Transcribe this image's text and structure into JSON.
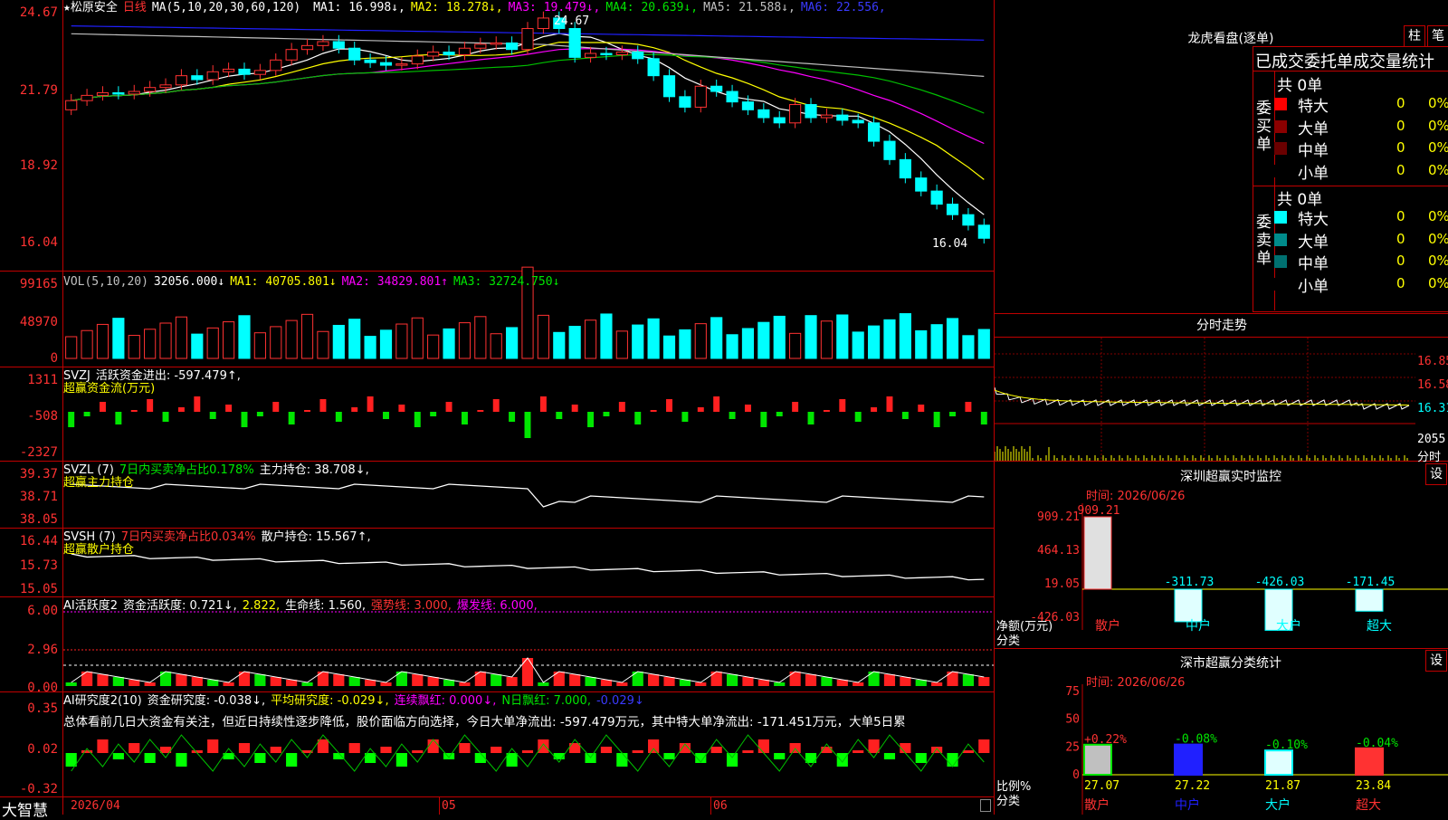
{
  "app": {
    "brand": "大智慧"
  },
  "stock": {
    "star": "★",
    "name": "松原安全",
    "period": "日线"
  },
  "main_panel": {
    "ma_label": "MA(5,10,20,30,60,120)",
    "ma": [
      {
        "name": "MA1",
        "value": "16.998↓",
        "color": "#ffffff"
      },
      {
        "name": "MA2",
        "value": "18.278↓",
        "color": "#ffff00"
      },
      {
        "name": "MA3",
        "value": "19.479↓",
        "color": "#ff00ff"
      },
      {
        "name": "MA4",
        "value": "20.639↓",
        "color": "#00e600"
      },
      {
        "name": "MA5",
        "value": "21.588↓",
        "color": "#c0c0c0"
      },
      {
        "name": "MA6",
        "value": "22.556",
        "color": "#3a3aff"
      }
    ],
    "y_ticks": [
      "24.67",
      "21.79",
      "18.92",
      "16.04"
    ],
    "high_label": "24.67",
    "low_label": "16.04"
  },
  "vol_panel": {
    "title": "VOL(5,10,20)",
    "value": "32056.000↓",
    "ma1": "MA1: 40705.801↓",
    "ma2": "MA2: 34829.801↑",
    "ma3": "MA3: 32724.750↓",
    "y_ticks": [
      "99165",
      "48970",
      "0"
    ]
  },
  "svzj_panel": {
    "title": "SVZJ",
    "label": "活跃资金进出: -597.479↑,",
    "sub": "超赢资金流(万元)",
    "y_ticks": [
      "1311",
      "-508",
      "-2327"
    ]
  },
  "svzl_panel": {
    "title": "SVZL (7)",
    "ratio": "7日内买卖净占比0.178%",
    "holding": "主力持仓: 38.708↓,",
    "sub": "超赢主力持仓",
    "y_ticks": [
      "39.37",
      "38.71",
      "38.05"
    ]
  },
  "svsh_panel": {
    "title": "SVSH (7)",
    "ratio": "7日内买卖净占比0.034%",
    "holding": "散户持仓: 15.567↑,",
    "sub": "超赢散户持仓",
    "y_ticks": [
      "16.44",
      "15.73",
      "15.05"
    ]
  },
  "ai_active_panel": {
    "title": "AI活跃度2",
    "active": "资金活跃度: 0.721↓,",
    "v2": "2.822,",
    "life": "生命线: 1.560,",
    "strong": "强势线: 3.000,",
    "burst": "爆发线: 6.000,",
    "y_ticks": [
      "6.00",
      "2.96",
      "0.00"
    ]
  },
  "ai_research_panel": {
    "title": "AI研究度2(10)",
    "research": "资金研究度: -0.038↓,",
    "avg": "平均研究度: -0.029↓,",
    "red_streak": "连续飘红: 0.000↓,",
    "n_red": "N日飘红: 7.000,",
    "last": "-0.029↓",
    "comment": "总体看前几日大资金有关注，但近日持续性逐步降低，股价面临方向选择，今日大单净流出: -597.479万元，其中特大单净流出: -171.451万元，大单5日累",
    "y_ticks": [
      "0.35",
      "0.02",
      "-0.32"
    ]
  },
  "x_axis": {
    "labels": [
      "2026/04",
      "05",
      "06"
    ]
  },
  "dragon_tiger": {
    "title": "龙虎看盘(逐单)",
    "btn_bar": "柱",
    "btn_pen": "笔",
    "header": "已成交委托单成交量统计",
    "buy_side": "委买单",
    "sell_side": "委卖单",
    "buy_total": "共 0单",
    "sell_total": "共 0单",
    "buy_rows": [
      {
        "label": "特大",
        "count": "0",
        "pct": "0%",
        "color": "#ff0000"
      },
      {
        "label": "大单",
        "count": "0",
        "pct": "0%",
        "color": "#8b0000"
      },
      {
        "label": "中单",
        "count": "0",
        "pct": "0%",
        "color": "#6a0000"
      },
      {
        "label": "小单",
        "count": "0",
        "pct": "0%",
        "color": "#000000"
      }
    ],
    "sell_rows": [
      {
        "label": "特大",
        "count": "0",
        "pct": "0%",
        "color": "#00ffff"
      },
      {
        "label": "大单",
        "count": "0",
        "pct": "0%",
        "color": "#008b8b"
      },
      {
        "label": "中单",
        "count": "0",
        "pct": "0%",
        "color": "#007070"
      },
      {
        "label": "小单",
        "count": "0",
        "pct": "0%",
        "color": "#000000"
      }
    ]
  },
  "intraday": {
    "title": "分时走势",
    "y_ticks": [
      "16.85",
      "16.58",
      "16.31"
    ],
    "vol_tick": "2055",
    "vol_unit": "分时"
  },
  "realtime_monitor": {
    "title": "深圳超赢实时监控",
    "btn": "设",
    "time": "时间: 2026/06/26",
    "y_ticks": [
      "909.21",
      "464.13",
      "19.05",
      "-426.03"
    ],
    "ylabel": "净额(万元)",
    "xlabel": "分类",
    "bars": [
      {
        "cat": "散户",
        "label": "909.21",
        "value": 909.21
      },
      {
        "cat": "中户",
        "label": "-311.73",
        "value": -311.73
      },
      {
        "cat": "大户",
        "label": "-426.03",
        "value": -426.03
      },
      {
        "cat": "超大",
        "label": "-171.45",
        "value": -171.45
      }
    ]
  },
  "category_stats": {
    "title": "深市超赢分类统计",
    "btn": "设",
    "time": "时间: 2026/06/26",
    "y_ticks": [
      "75",
      "50",
      "25",
      "0"
    ],
    "ylabel": "比例%",
    "xlabel": "分类",
    "bars": [
      {
        "cat": "散户",
        "top": "+0.22%",
        "value": 27.07,
        "label": "27.07"
      },
      {
        "cat": "中户",
        "top": "-0.08%",
        "value": 27.22,
        "label": "27.22"
      },
      {
        "cat": "大户",
        "top": "-0.10%",
        "value": 21.87,
        "label": "21.87"
      },
      {
        "cat": "超大",
        "top": "-0.04%",
        "value": 23.84,
        "label": "23.84"
      }
    ]
  }
}
